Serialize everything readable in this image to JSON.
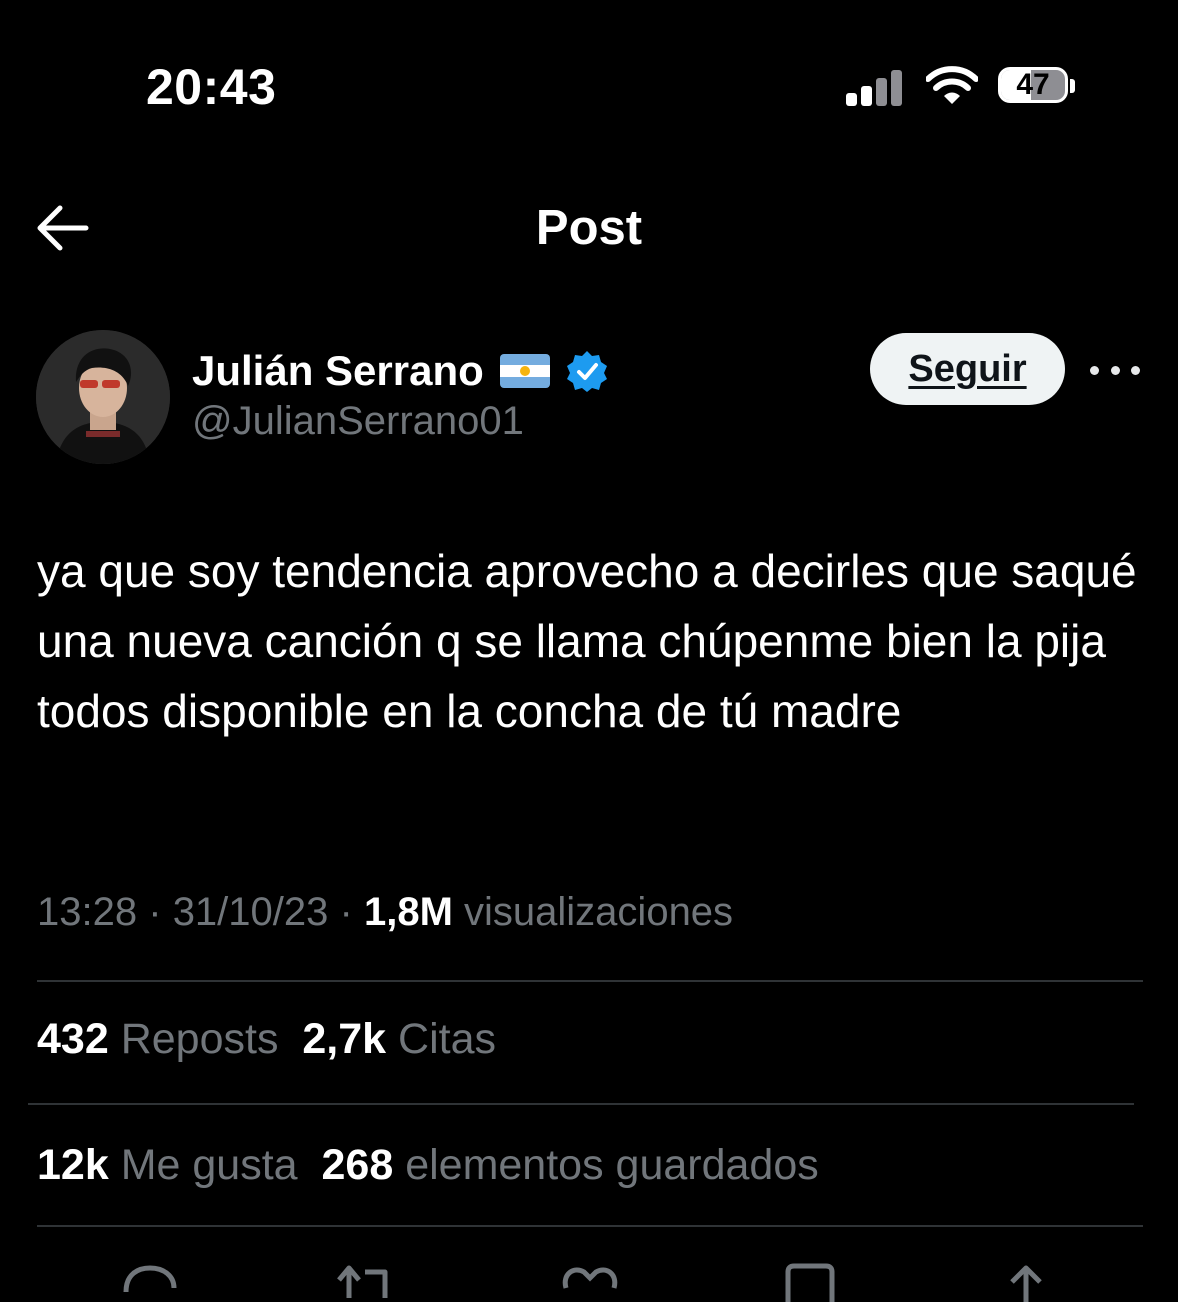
{
  "status_bar": {
    "time": "20:43",
    "battery": "47",
    "battery_level": 0.47
  },
  "header": {
    "title": "Post"
  },
  "author": {
    "name": "Julián Serrano",
    "handle": "@JulianSerrano01",
    "verified": true,
    "flag": "argentina-flag-icon",
    "follow_label": "Seguir"
  },
  "post": {
    "text": "ya que soy tendencia aprovecho a decirles que saqué una nueva canción q se llama chúpenme bien la pija todos disponible en la concha de tú madre",
    "time": "13:28",
    "separator": "·",
    "date": "31/10/23",
    "views_count": "1,8M",
    "views_label": "visualizaciones"
  },
  "stats": {
    "reposts_count": "432",
    "reposts_label": "Reposts",
    "quotes_count": "2,7k",
    "quotes_label": "Citas",
    "likes_count": "12k",
    "likes_label": "Me gusta",
    "bookmarks_count": "268",
    "bookmarks_label": "elementos guardados"
  },
  "colors": {
    "background": "#000000",
    "text_primary": "#e7e9ea",
    "text_secondary": "#71767b",
    "verified_blue": "#1d9bf0",
    "divider": "#2f3336"
  },
  "actions": [
    "reply-icon",
    "repost-icon",
    "like-icon",
    "bookmark-icon",
    "share-icon"
  ]
}
